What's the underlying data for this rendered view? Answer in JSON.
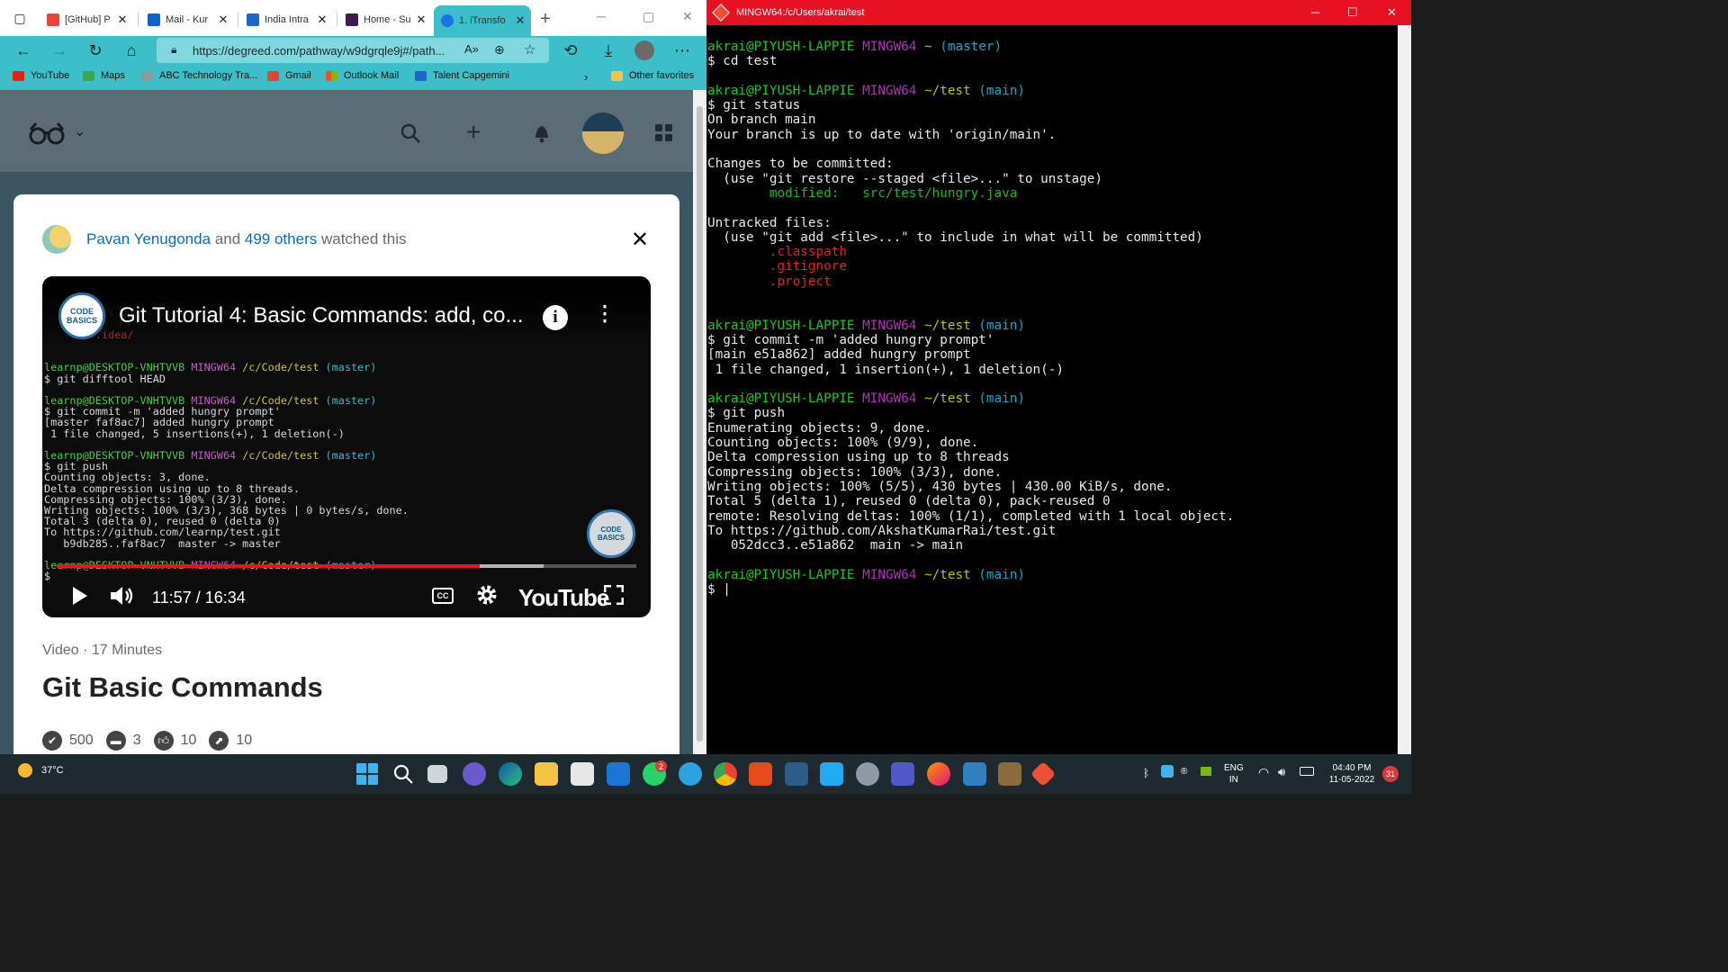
{
  "browser": {
    "tabs": [
      {
        "title": "[GitHub] P",
        "color": "#ea4335"
      },
      {
        "title": "Mail - Kur",
        "color": "#0a64c8"
      },
      {
        "title": "India Intra",
        "color": "#1b68c9"
      },
      {
        "title": "Home - Su",
        "color": "#3a1c4f"
      },
      {
        "title": "1. iTransfo",
        "color": "#1a73e8"
      }
    ],
    "url": "https://degreed.com/pathway/w9dgrqle9j#/path...",
    "favorites": [
      "YouTube",
      "Maps",
      "ABC Technology Tra...",
      "Gmail",
      "Outlook Mail",
      "Talent Capgemini"
    ],
    "other_favorites": "Other favorites",
    "icons": [
      "tab-actions-icon",
      "back-icon",
      "forward-icon",
      "refresh-icon",
      "home-icon",
      "lock-icon",
      "read-aloud-icon",
      "zoom-icon",
      "add-favorite-icon",
      "history-icon",
      "downloads-icon",
      "profile-icon",
      "more-icon"
    ]
  },
  "card": {
    "watcher_name": "Pavan Yenugonda",
    "and": "and",
    "others": "499 others",
    "watched": "watched this",
    "video": {
      "title": "Git Tutorial 4: Basic Commands: add, co...",
      "channel_logo": "CODE BASICS",
      "time": "11:57 / 16:34",
      "progress": 0.73,
      "cc": "CC",
      "brand": "YouTube"
    },
    "meta": "Video · 17 Minutes",
    "heading": "Git Basic Commands",
    "stats": {
      "completions": "500",
      "comments": "3",
      "likes": "10",
      "recommends": "10"
    }
  },
  "terminal": {
    "title": "MINGW64:/c/Users/akrai/test"
  },
  "taskbar": {
    "weather": "37°C",
    "lang": "ENG",
    "region": "IN",
    "time": "04:40 PM",
    "date": "11-05-2022",
    "whatsapp_badge": "2",
    "notif_badge": "31"
  }
}
